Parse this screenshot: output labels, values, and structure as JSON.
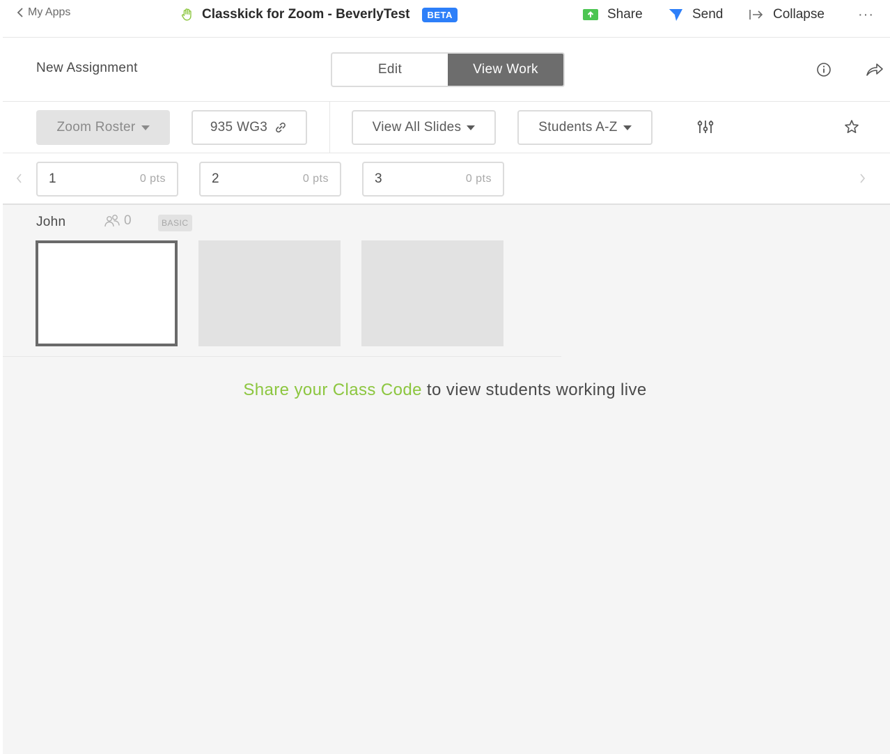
{
  "topbar": {
    "back_label": "My Apps",
    "app_title": "Classkick for Zoom - BeverlyTest",
    "beta_label": "BETA",
    "share_label": "Share",
    "send_label": "Send",
    "collapse_label": "Collapse",
    "more_label": "···"
  },
  "assignment": {
    "title": "New Assignment",
    "tabs": [
      {
        "label": "Edit",
        "active": false
      },
      {
        "label": "View Work",
        "active": true
      }
    ]
  },
  "filters": {
    "roster_label": "Zoom Roster",
    "class_code": "935 WG3",
    "slides_filter": "View All Slides",
    "sort_label": "Students A-Z"
  },
  "slides": [
    {
      "number": "1",
      "points": "0 pts"
    },
    {
      "number": "2",
      "points": "0 pts"
    },
    {
      "number": "3",
      "points": "0 pts"
    }
  ],
  "students": [
    {
      "name": "John",
      "helpers": "0",
      "badge": "BASIC"
    }
  ],
  "message": {
    "link_text": "Share your Class Code",
    "rest_text": " to view students working live"
  },
  "colors": {
    "accent_green": "#8cc63f",
    "beta_blue": "#2d7ff9",
    "active_tab": "#6d6d6d",
    "share_icon_green": "#4cc552",
    "send_icon_blue": "#2d7ff9"
  },
  "icons": [
    "chevron-left-icon",
    "raised-hand-icon",
    "share-upload-icon",
    "send-plane-icon",
    "collapse-arrow-icon",
    "info-icon",
    "share-arrow-icon",
    "link-icon",
    "sliders-icon",
    "star-icon",
    "helpers-icon",
    "chevron-right-icon"
  ]
}
